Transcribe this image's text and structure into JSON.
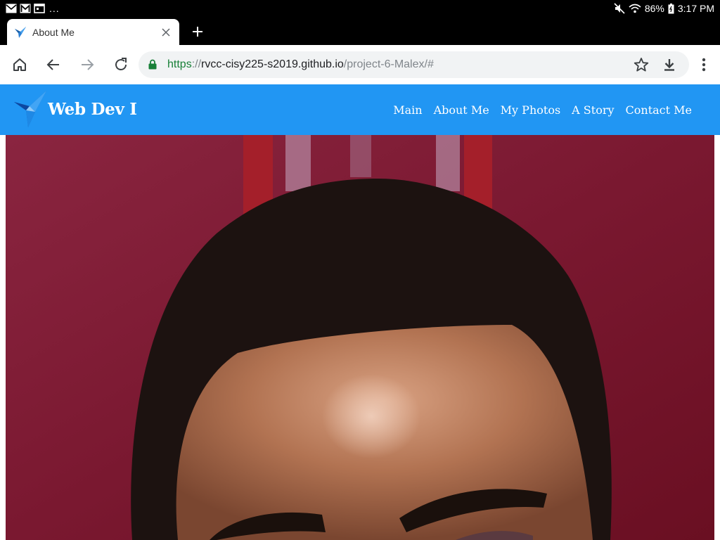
{
  "status_bar": {
    "more": "...",
    "battery": "86%",
    "time": "3:17 PM",
    "icons": [
      "gmail-icon",
      "gmail-icon",
      "calendar-icon",
      "mute-icon",
      "wifi-icon",
      "battery-icon"
    ]
  },
  "tab": {
    "title": "About Me",
    "favicon": "bird-logo-icon"
  },
  "toolbar": {
    "url_scheme": "https",
    "url_sep": "://",
    "url_host": "rvcc-cisy225-s2019.github.io",
    "url_path": "/project-6-Malex/#"
  },
  "site": {
    "brand": "Web Dev I",
    "brand_color": "#2196f3",
    "nav": [
      "Main",
      "About Me",
      "My Photos",
      "A Story",
      "Contact Me"
    ]
  },
  "content": {
    "photo_icon": "portrait-photo"
  }
}
